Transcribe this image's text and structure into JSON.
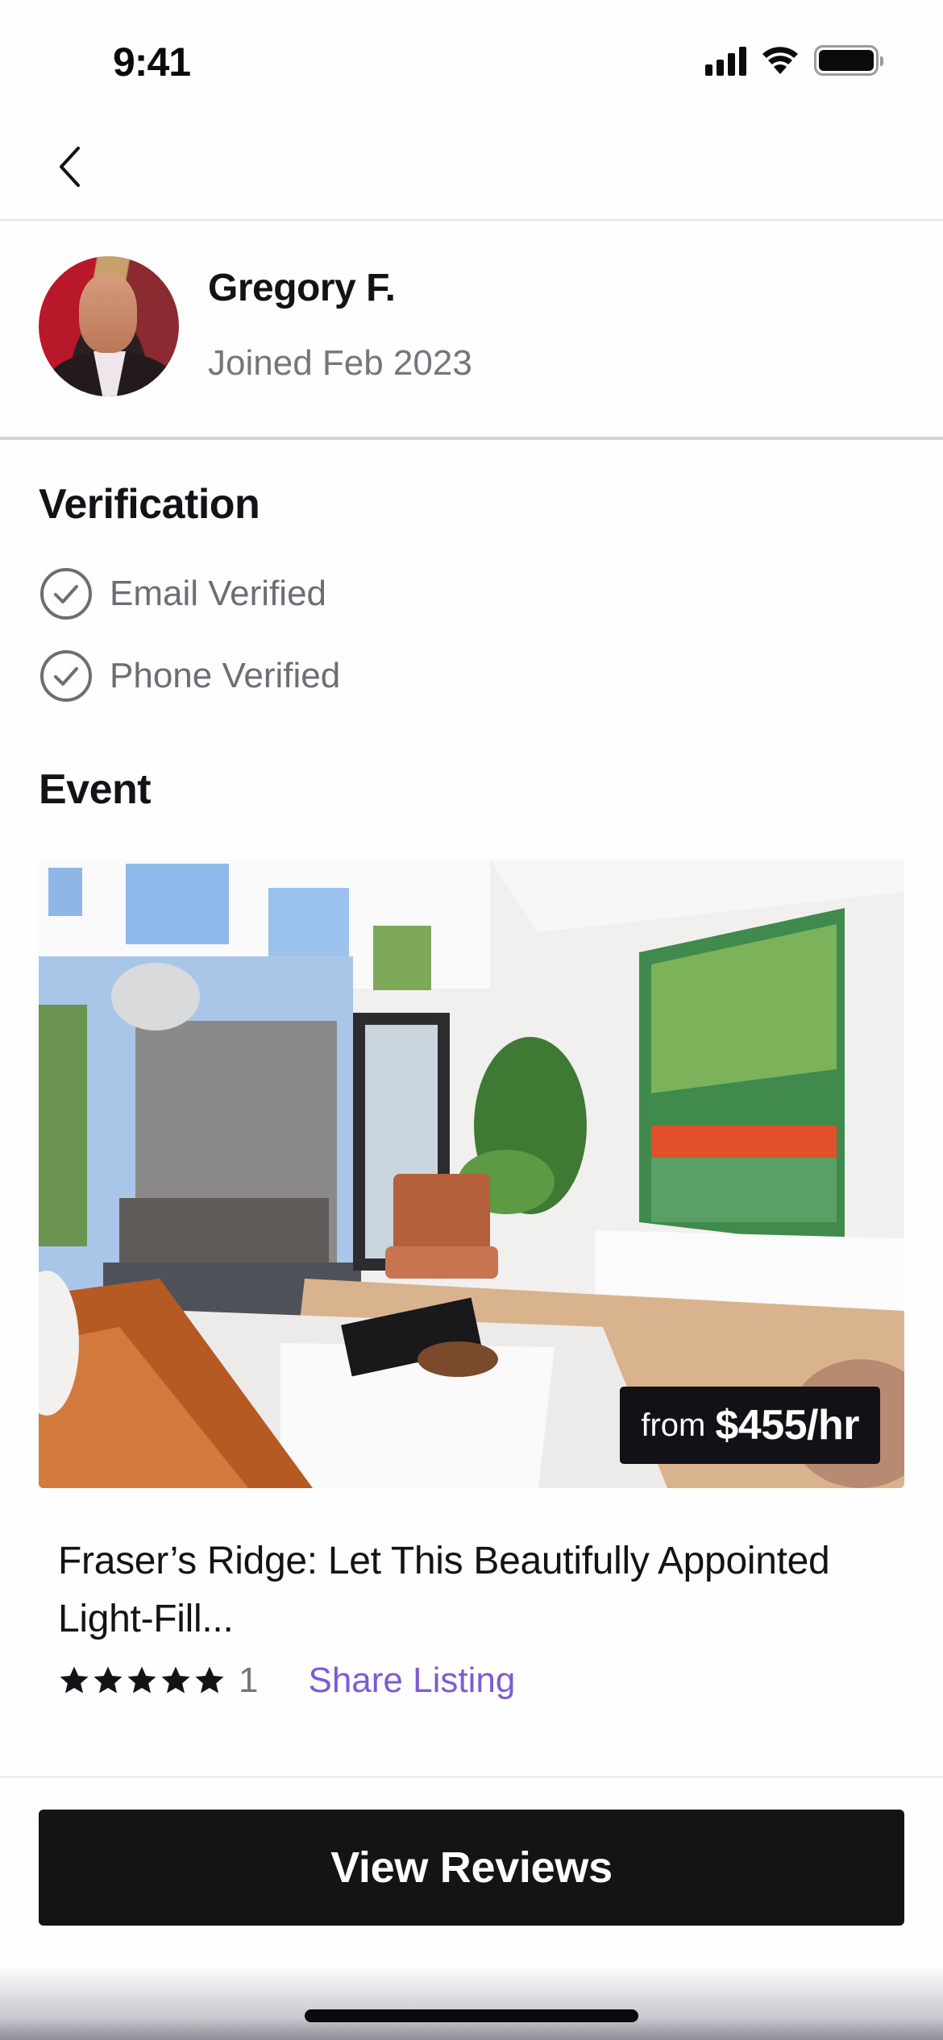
{
  "status_bar": {
    "time": "9:41",
    "icons": [
      "cellular-signal-icon",
      "wifi-icon",
      "battery-icon"
    ]
  },
  "nav": {
    "back_icon": "chevron-left-icon"
  },
  "profile": {
    "name": "Gregory F.",
    "joined": "Joined Feb 2023",
    "avatar": "host-photo"
  },
  "verification": {
    "title": "Verification",
    "items": [
      {
        "label": "Email Verified",
        "icon": "check-circle-icon"
      },
      {
        "label": "Phone Verified",
        "icon": "check-circle-icon"
      }
    ]
  },
  "event": {
    "title": "Event",
    "listing": {
      "image": "living-room-photo",
      "price_prefix": "from",
      "price": "$455/hr",
      "title": "Fraser’s Ridge: Let This Beautifully Appointed Light-Fill...",
      "rating_stars": 5,
      "rating_max": 5,
      "review_count": "1",
      "share_label": "Share Listing"
    }
  },
  "actions": {
    "view_reviews_label": "View Reviews"
  },
  "colors": {
    "text_primary": "#141217",
    "text_secondary": "#76757b",
    "link": "#7e5bd3",
    "button_bg": "#151316",
    "badge_bg": "#131115"
  }
}
